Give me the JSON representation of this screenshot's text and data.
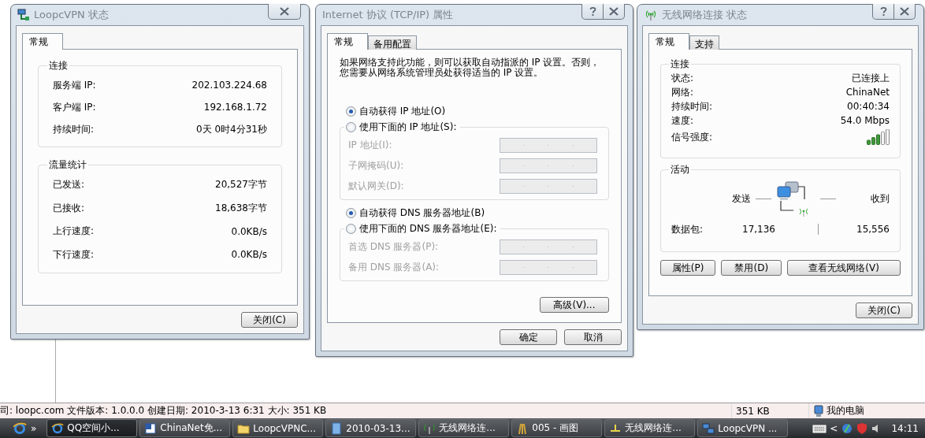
{
  "vpn_dialog": {
    "title": "LoopcVPN 状态",
    "tabs": [
      {
        "label": "常规",
        "selected": true
      }
    ],
    "connection": {
      "legend": "连接",
      "rows": [
        {
          "label": "服务端 IP:",
          "value": "202.103.224.68"
        },
        {
          "label": "客户端 IP:",
          "value": "192.168.1.72"
        },
        {
          "label": "持续时间:",
          "value": "0天 0时4分31秒"
        }
      ]
    },
    "traffic": {
      "legend": "流量统计",
      "rows": [
        {
          "label": "已发送:",
          "value": "20,527字节"
        },
        {
          "label": "已接收:",
          "value": "18,638字节"
        },
        {
          "label": "上行速度:",
          "value": "0.0KB/s"
        },
        {
          "label": "下行速度:",
          "value": "0.0KB/s"
        }
      ]
    },
    "close_button": "关闭(C)"
  },
  "tcpip_dialog": {
    "title": "Internet 协议 (TCP/IP) 属性",
    "tabs": [
      {
        "label": "常规",
        "selected": true
      },
      {
        "label": "备用配置",
        "selected": false
      }
    ],
    "intro_lines": [
      "如果网络支持此功能，则可以获取自动指派的 IP 设置。否则，",
      "您需要从网络系统管理员处获得适当的 IP 设置。"
    ],
    "ip_options": [
      {
        "label": "自动获得 IP 地址(O)",
        "selected": true
      },
      {
        "label": "使用下面的 IP 地址(S):",
        "selected": false
      }
    ],
    "ip_fields": [
      {
        "label": "IP 地址(I):",
        "disabled": true
      },
      {
        "label": "子网掩码(U):",
        "disabled": true
      },
      {
        "label": "默认网关(D):",
        "disabled": true
      }
    ],
    "dns_options": [
      {
        "label": "自动获得 DNS 服务器地址(B)",
        "selected": true
      },
      {
        "label": "使用下面的 DNS 服务器地址(E):",
        "selected": false
      }
    ],
    "dns_fields": [
      {
        "label": "首选 DNS 服务器(P):",
        "disabled": true
      },
      {
        "label": "备用 DNS 服务器(A):",
        "disabled": true
      }
    ],
    "advanced_button": "高级(V)...",
    "ok_button": "确定",
    "cancel_button": "取消"
  },
  "wireless_dialog": {
    "title": "无线网络连接 状态",
    "tabs": [
      {
        "label": "常规",
        "selected": true
      },
      {
        "label": "支持",
        "selected": false
      }
    ],
    "connection": {
      "legend": "连接",
      "rows": [
        {
          "label": "状态:",
          "value": "已连接上"
        },
        {
          "label": "网络:",
          "value": "ChinaNet"
        },
        {
          "label": "持续时间:",
          "value": "00:40:34"
        },
        {
          "label": "速度:",
          "value": "54.0 Mbps"
        }
      ],
      "signal_label": "信号强度:"
    },
    "activity": {
      "legend": "活动",
      "sent_label": "发送",
      "received_label": "收到",
      "packets_label": "数据包:",
      "packets_sent": "17,136",
      "packets_received": "15,556"
    },
    "buttons": [
      "属性(P)",
      "禁用(D)",
      "查看无线网络(V)"
    ],
    "close_button": "关闭(C)"
  },
  "status_bar": {
    "info": "司: loopc.com 文件版本: 1.0.0.0 创建日期: 2010-3-13 6:31 大小: 351 KB",
    "size": "351 KB",
    "location": "我的电脑"
  },
  "taskbar": {
    "more": "»",
    "tasks": [
      {
        "label": "QQ空间小...",
        "selected": true,
        "kind": "browser"
      },
      {
        "label": "ChinaNet免...",
        "selected": false,
        "kind": "document"
      },
      {
        "label": "LoopcVPNC...",
        "selected": false,
        "kind": "folder"
      },
      {
        "label": "2010-03-13...",
        "selected": false,
        "kind": "image"
      },
      {
        "label": "无线网络连...",
        "selected": false,
        "kind": "wireless"
      },
      {
        "label": "005 - 画图",
        "selected": false,
        "kind": "paint"
      },
      {
        "label": "无线网络连...",
        "selected": false,
        "kind": "network"
      },
      {
        "label": "LoopcVPN ...",
        "selected": false,
        "kind": "vpn"
      }
    ],
    "tray_expand": "<",
    "clock": "14:11"
  }
}
